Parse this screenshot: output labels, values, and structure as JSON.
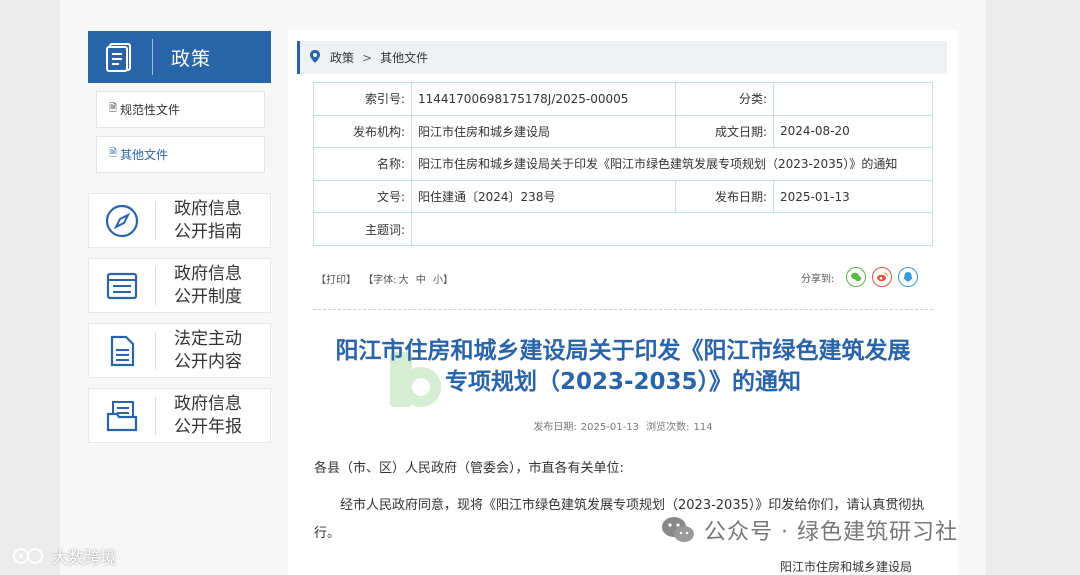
{
  "sidebar": {
    "header": {
      "title": "政策",
      "icon": "book-icon"
    },
    "sub_items": [
      {
        "label": "规范性文件",
        "icon": "doc-icon"
      },
      {
        "label": "其他文件",
        "icon": "doc-icon"
      }
    ],
    "cards": [
      {
        "line1": "政府信息",
        "line2": "公开指南",
        "icon": "compass-icon"
      },
      {
        "line1": "政府信息",
        "line2": "公开制度",
        "icon": "list-icon"
      },
      {
        "line1": "法定主动",
        "line2": "公开内容",
        "icon": "document-icon"
      },
      {
        "line1": "政府信息",
        "line2": "公开年报",
        "icon": "folder-icon"
      }
    ]
  },
  "breadcrumb": {
    "home": "政策",
    "current": "其他文件"
  },
  "meta": {
    "index_label": "索引号:",
    "index_value": "11441700698175178J/2025-00005",
    "category_label": "分类:",
    "category_value": "",
    "publisher_label": "发布机构:",
    "publisher_value": "阳江市住房和城乡建设局",
    "created_label": "成文日期:",
    "created_value": "2024-08-20",
    "name_label": "名称:",
    "name_value": "阳江市住房和城乡建设局关于印发《阳江市绿色建筑发展专项规划（2023-2035）》的通知",
    "docno_label": "文号:",
    "docno_value": "阳住建通〔2024〕238号",
    "pubdate_label": "发布日期:",
    "pubdate_value": "2025-01-13",
    "keywords_label": "主题词:",
    "keywords_value": ""
  },
  "tools": {
    "print": "【打印】",
    "font_prefix": "【字体:",
    "big": "大",
    "mid": "中",
    "small": "小",
    "font_suffix": "】",
    "share_label": "分享到:"
  },
  "article": {
    "title_line1": "阳江市住房和城乡建设局关于印发《阳江市绿色建筑发展",
    "title_line2": "专项规划（2023-2035）》的通知",
    "date_label": "发布日期:",
    "date_value": "2025-01-13",
    "views_label": "浏览次数:",
    "views_value": "114",
    "salutation": "各县（市、区）人民政府（管委会），市直各有关单位:",
    "body": "经市人民政府同意，现将《阳江市绿色建筑发展专项规划（2023-2035）》印发给你们，请认真贯彻执行。",
    "signature": "阳江市住房和城乡建设局"
  },
  "watermarks": {
    "wechat": "公众号 · 绿色建筑研习社",
    "corner": "大数跨境"
  },
  "colors": {
    "accent": "#2a64a8",
    "wechat_green": "#5bb946",
    "weibo_red": "#e3553c",
    "qq_blue": "#3a9bd8"
  }
}
